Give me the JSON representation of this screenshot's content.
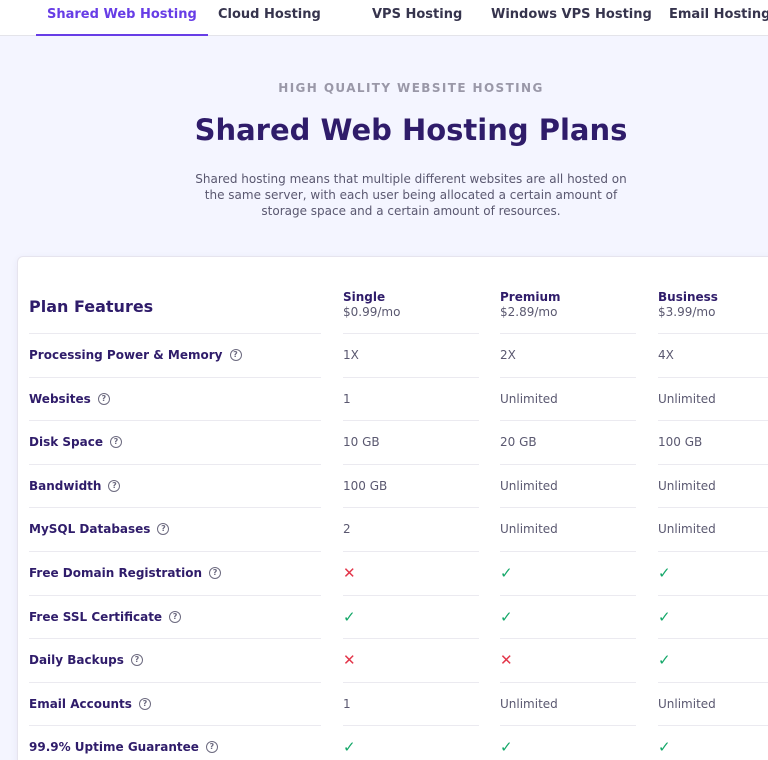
{
  "tabs": [
    {
      "label": "Shared Web Hosting",
      "active": true
    },
    {
      "label": "Cloud Hosting",
      "active": false
    },
    {
      "label": "VPS Hosting",
      "active": false
    },
    {
      "label": "Windows VPS Hosting",
      "active": false
    },
    {
      "label": "Email Hosting",
      "active": false
    }
  ],
  "hero": {
    "kicker": "HIGH QUALITY WEBSITE HOSTING",
    "title": "Shared Web Hosting Plans",
    "description": "Shared hosting means that multiple different websites are all hosted on the same server, with each user being allocated a certain amount of storage space and a certain amount of resources."
  },
  "table": {
    "features_header": "Plan Features",
    "plans": [
      {
        "name": "Single",
        "price": "$0.99/mo"
      },
      {
        "name": "Premium",
        "price": "$2.89/mo"
      },
      {
        "name": "Business",
        "price": "$3.99/mo"
      }
    ],
    "help_icon": "?",
    "check_icon": "✓",
    "cross_icon": "✕",
    "rows": [
      {
        "feature": "Processing Power & Memory",
        "values": [
          "1X",
          "2X",
          "4X"
        ]
      },
      {
        "feature": "Websites",
        "values": [
          "1",
          "Unlimited",
          "Unlimited"
        ]
      },
      {
        "feature": "Disk Space",
        "values": [
          "10 GB",
          "20 GB",
          "100 GB"
        ]
      },
      {
        "feature": "Bandwidth",
        "values": [
          "100 GB",
          "Unlimited",
          "Unlimited"
        ]
      },
      {
        "feature": "MySQL Databases",
        "values": [
          "2",
          "Unlimited",
          "Unlimited"
        ]
      },
      {
        "feature": "Free Domain Registration",
        "values": [
          "no",
          "yes",
          "yes"
        ]
      },
      {
        "feature": "Free SSL Certificate",
        "values": [
          "yes",
          "yes",
          "yes"
        ]
      },
      {
        "feature": "Daily Backups",
        "values": [
          "no",
          "no",
          "yes"
        ]
      },
      {
        "feature": "Email Accounts",
        "values": [
          "1",
          "Unlimited",
          "Unlimited"
        ]
      },
      {
        "feature": "99.9% Uptime Guarantee",
        "values": [
          "yes",
          "yes",
          "yes"
        ]
      }
    ]
  },
  "colors": {
    "accent": "#673de6",
    "heading": "#2f1c6a",
    "check": "#16a86a",
    "cross": "#e3364a",
    "background": "#f4f5ff"
  }
}
